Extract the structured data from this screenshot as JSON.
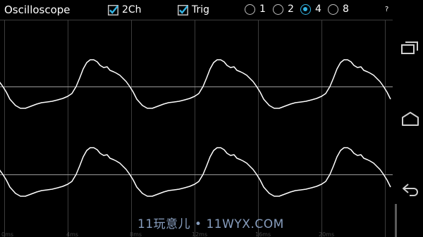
{
  "header": {
    "title": "Oscilloscope",
    "two_channel": {
      "label": "2Ch",
      "checked": true
    },
    "trigger": {
      "label": "Trig",
      "checked": true
    },
    "help": "?"
  },
  "timebase": {
    "options": [
      "1",
      "2",
      "4",
      "8"
    ],
    "selected": "4"
  },
  "scope": {
    "x_ticks": [
      "0ms",
      "4ms",
      "8ms",
      "12ms",
      "16ms",
      "20ms"
    ]
  },
  "watermark": "11玩意儿 • 11WYX.COM",
  "colors": {
    "accent": "#33b5e5",
    "trace": "#ffffff",
    "grid": "#3c3c3c",
    "baseline": "#9a9a9a"
  },
  "navbar": {
    "icons": [
      "recent-apps-icon",
      "home-icon",
      "back-icon"
    ]
  }
}
